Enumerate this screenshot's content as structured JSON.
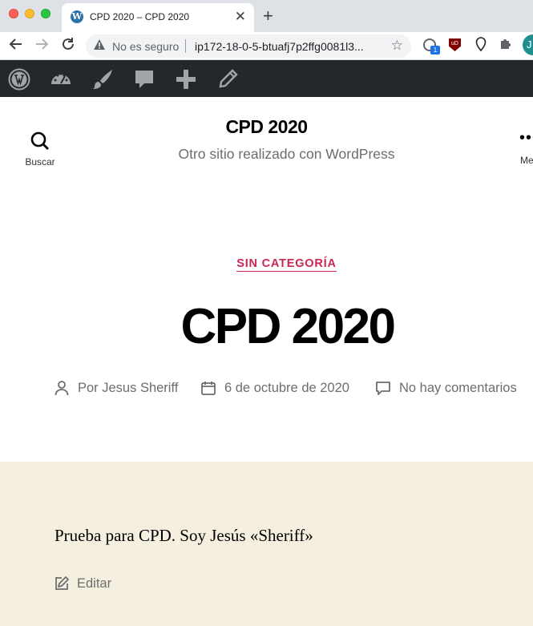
{
  "browser": {
    "tab_title": "CPD 2020 – CPD 2020",
    "tab_close": "✕",
    "new_tab": "+",
    "security_label": "No es seguro",
    "url": "ip172-18-0-5-btuafj7p2ffg0081l3...",
    "extension_badge": "1",
    "extension_ublock": "uD",
    "profile_initial": "J"
  },
  "site": {
    "title": "CPD 2020",
    "description": "Otro sitio realizado con WordPress",
    "search_label": "Buscar",
    "menu_label": "Menú"
  },
  "post": {
    "category": "SIN CATEGORÍA",
    "title": "CPD 2020",
    "author": "Por Jesus Sheriff",
    "date": "6 de octubre de 2020",
    "comments": "No hay comentarios",
    "body": "Prueba para CPD. Soy Jesús «Sheriff»",
    "edit_label": "Editar"
  }
}
